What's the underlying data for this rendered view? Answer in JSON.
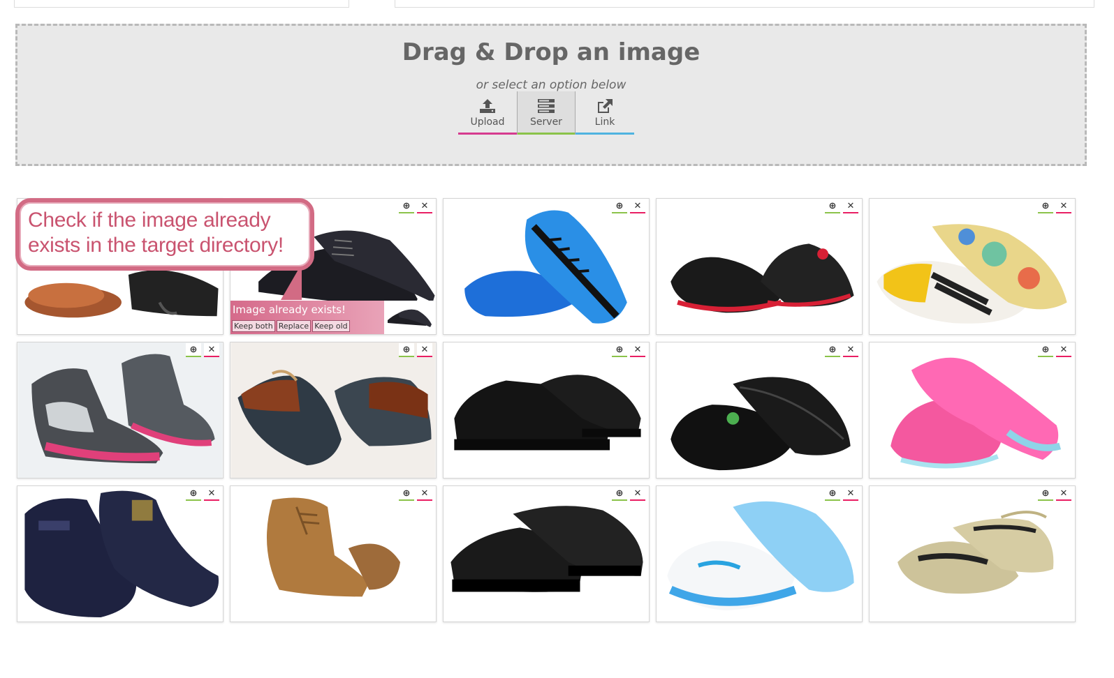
{
  "dropzone": {
    "title": "Drag & Drop an image",
    "subtitle": "or select an option below",
    "options": [
      {
        "label": "Upload",
        "icon": "upload-icon",
        "color": "#d63b8f"
      },
      {
        "label": "Server",
        "icon": "server-icon",
        "color": "#8bc34a"
      },
      {
        "label": "Link",
        "icon": "external-link-icon",
        "color": "#4fb3e0"
      }
    ]
  },
  "callout": {
    "text": "Check if the image already exists in the target directory!"
  },
  "exists_prompt": {
    "title": "Image already exists!",
    "keep_both": "Keep both",
    "replace": "Replace",
    "keep_old": "Keep old"
  },
  "tile_actions": {
    "zoom_icon": "zoom-in-icon",
    "delete_icon": "close-icon",
    "zoom_glyph": "⊕",
    "delete_glyph": "✕"
  },
  "images": [
    {
      "name": "brown-leather-oxford-shoes"
    },
    {
      "name": "black-leather-dress-shoes"
    },
    {
      "name": "blue-black-sneakers"
    },
    {
      "name": "black-red-basketball-sneakers"
    },
    {
      "name": "colorful-print-sneakers"
    },
    {
      "name": "pink-gray-high-top-sneakers"
    },
    {
      "name": "brown-navy-boat-shoes"
    },
    {
      "name": "black-suede-platform-shoes"
    },
    {
      "name": "black-running-sneakers"
    },
    {
      "name": "pink-running-sneakers"
    },
    {
      "name": "navy-work-boots"
    },
    {
      "name": "tan-suede-wedge-boots"
    },
    {
      "name": "black-boat-shoes"
    },
    {
      "name": "white-blue-running-sneakers"
    },
    {
      "name": "gold-pointed-flats"
    }
  ]
}
